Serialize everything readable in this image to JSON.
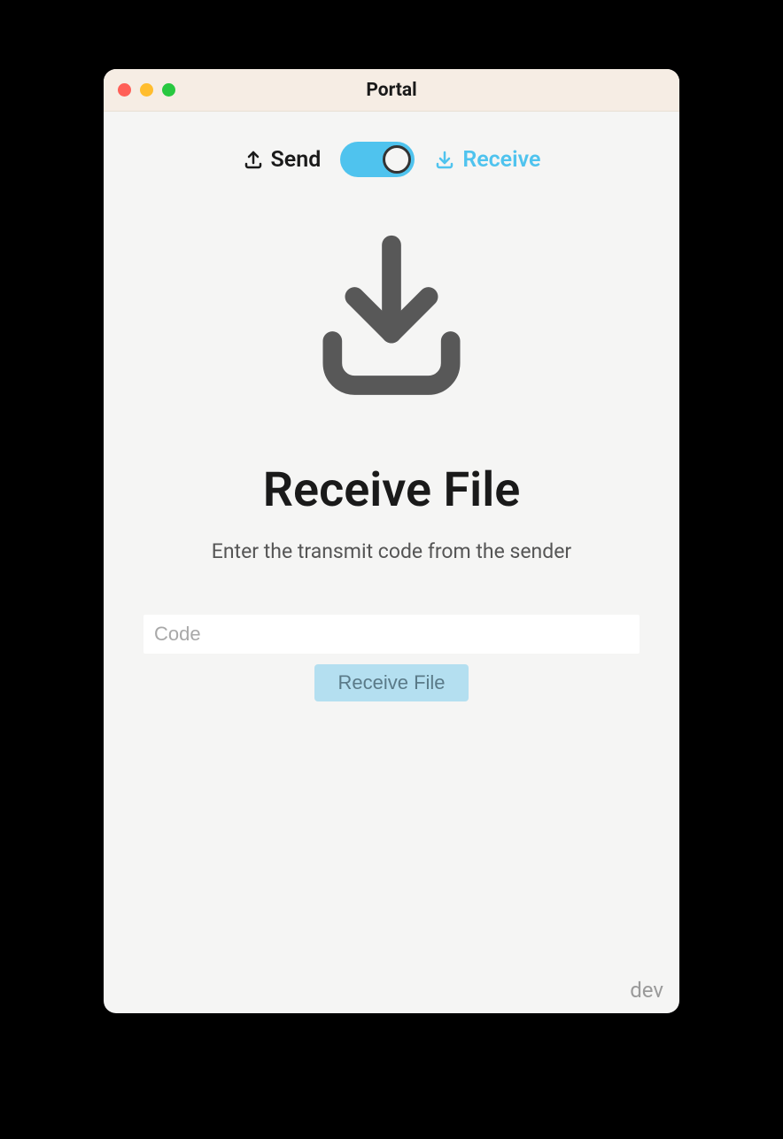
{
  "window": {
    "title": "Portal"
  },
  "mode": {
    "send_label": "Send",
    "receive_label": "Receive"
  },
  "main": {
    "heading": "Receive File",
    "subheading": "Enter the transmit code from the sender",
    "code_placeholder": "Code",
    "code_value": "",
    "button_label": "Receive File"
  },
  "footer": {
    "version": "dev"
  }
}
